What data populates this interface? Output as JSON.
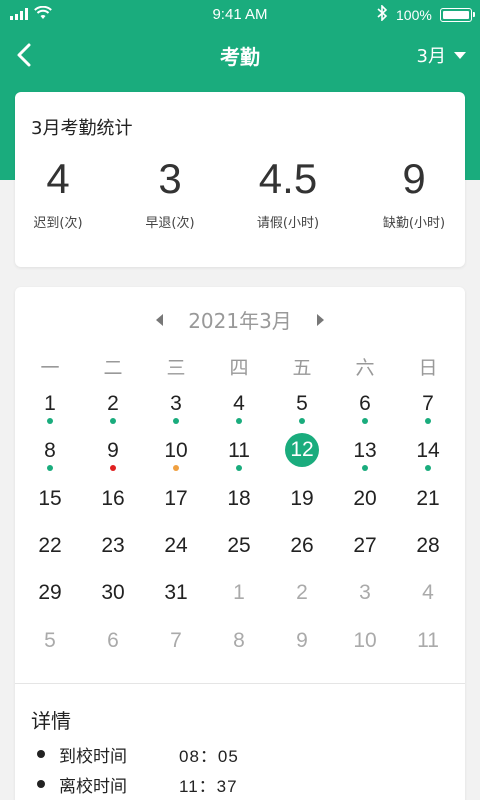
{
  "status_bar": {
    "time": "9:41 AM",
    "battery": "100%"
  },
  "nav": {
    "title": "考勤",
    "month_selector": "3月",
    "back_icon": "chevron-left-icon"
  },
  "stats": {
    "title": "3月考勤统计",
    "items": [
      {
        "value": "4",
        "label": "迟到(次)"
      },
      {
        "value": "3",
        "label": "早退(次)"
      },
      {
        "value": "4.5",
        "label": "请假(小时)"
      },
      {
        "value": "9",
        "label": "缺勤(小时)"
      }
    ]
  },
  "calendar": {
    "year_month": "2021年3月",
    "weekdays": [
      "一",
      "二",
      "三",
      "四",
      "五",
      "六",
      "日"
    ],
    "colors": {
      "normal": "#1aac7d",
      "absent": "#e02020",
      "late": "#f0a040"
    },
    "weeks": [
      [
        {
          "d": "1",
          "dot": "normal"
        },
        {
          "d": "2",
          "dot": "normal"
        },
        {
          "d": "3",
          "dot": "normal"
        },
        {
          "d": "4",
          "dot": "normal"
        },
        {
          "d": "5",
          "dot": "normal"
        },
        {
          "d": "6",
          "dot": "normal"
        },
        {
          "d": "7",
          "dot": "normal"
        }
      ],
      [
        {
          "d": "8",
          "dot": "normal"
        },
        {
          "d": "9",
          "dot": "absent"
        },
        {
          "d": "10",
          "dot": "late"
        },
        {
          "d": "11",
          "dot": "normal"
        },
        {
          "d": "12",
          "today": true
        },
        {
          "d": "13",
          "dot": "normal"
        },
        {
          "d": "14",
          "dot": "normal"
        }
      ],
      [
        {
          "d": "15"
        },
        {
          "d": "16"
        },
        {
          "d": "17"
        },
        {
          "d": "18"
        },
        {
          "d": "19"
        },
        {
          "d": "20"
        },
        {
          "d": "21"
        }
      ],
      [
        {
          "d": "22"
        },
        {
          "d": "23"
        },
        {
          "d": "24"
        },
        {
          "d": "25"
        },
        {
          "d": "26"
        },
        {
          "d": "27"
        },
        {
          "d": "28"
        }
      ],
      [
        {
          "d": "29"
        },
        {
          "d": "30"
        },
        {
          "d": "31"
        },
        {
          "d": "1",
          "other": true
        },
        {
          "d": "2",
          "other": true
        },
        {
          "d": "3",
          "other": true
        },
        {
          "d": "4",
          "other": true
        }
      ],
      [
        {
          "d": "5",
          "other": true
        },
        {
          "d": "6",
          "other": true
        },
        {
          "d": "7",
          "other": true
        },
        {
          "d": "8",
          "other": true
        },
        {
          "d": "9",
          "other": true
        },
        {
          "d": "10",
          "other": true
        },
        {
          "d": "11",
          "other": true
        }
      ]
    ]
  },
  "details": {
    "title": "详情",
    "items": [
      {
        "label": "到校时间",
        "value": "08：05"
      },
      {
        "label": "离校时间",
        "value": "11：37"
      }
    ]
  }
}
